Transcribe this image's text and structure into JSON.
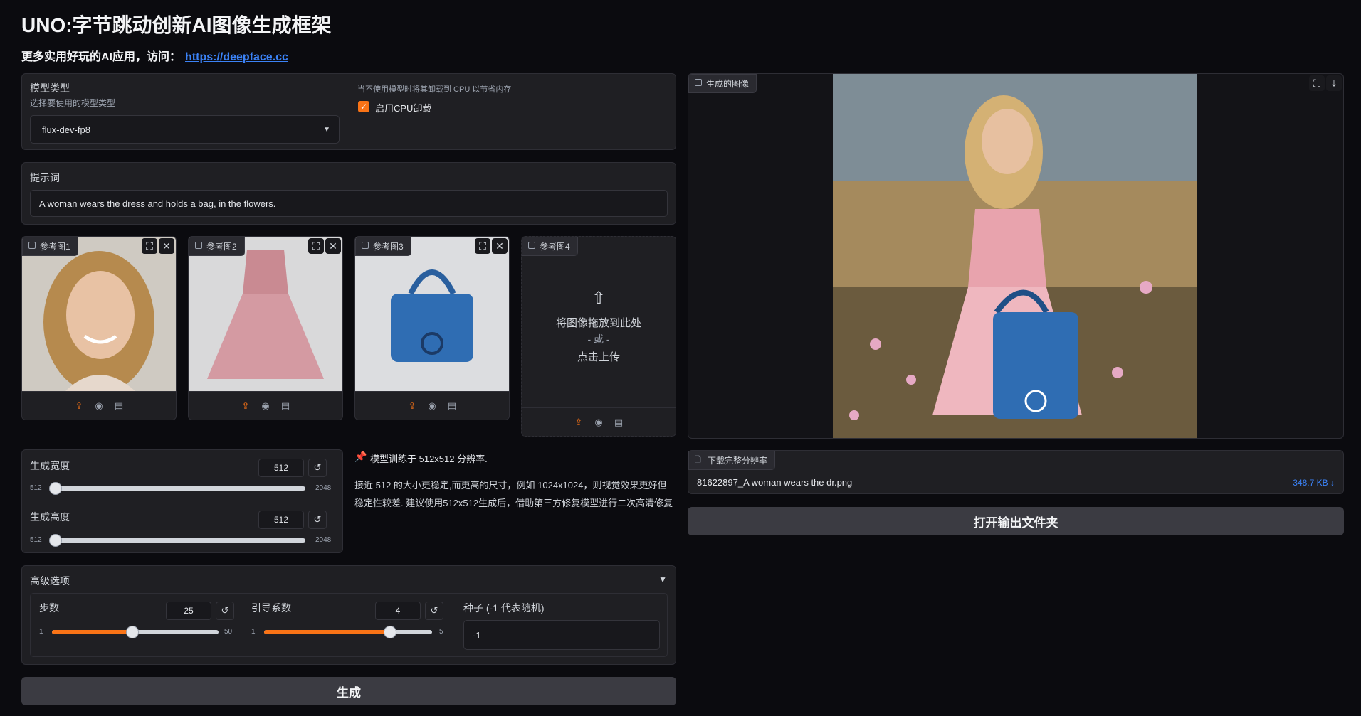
{
  "header": {
    "title": "UNO:字节跳动创新AI图像生成框架",
    "subtitle_prefix": "更多实用好玩的AI应用，访问：",
    "link": "https://deepface.cc"
  },
  "model": {
    "label": "模型类型",
    "sublabel": "选择要使用的模型类型",
    "value": "flux-dev-fp8",
    "cpu_note": "当不使用模型时将其卸载到 CPU 以节省内存",
    "cpu_label": "启用CPU卸载",
    "cpu_checked": true
  },
  "prompt": {
    "label": "提示词",
    "value": "A woman wears the dress and holds a bag, in the flowers."
  },
  "refs": [
    {
      "label": "参考图1"
    },
    {
      "label": "参考图2"
    },
    {
      "label": "参考图3"
    },
    {
      "label": "参考图4",
      "drop_text": "将图像拖放到此处",
      "or_text": "- 或 -",
      "click_text": "点击上传"
    }
  ],
  "size": {
    "width_label": "生成宽度",
    "width_value": "512",
    "height_label": "生成高度",
    "height_value": "512",
    "min": "512",
    "max": "2048"
  },
  "note": {
    "title": "模型训练于 512x512 分辨率.",
    "body": "接近 512 的大小更稳定,而更高的尺寸，例如 1024x1024，则视觉效果更好但稳定性较差. 建议使用512x512生成后，借助第三方修复模型进行二次高清修复"
  },
  "advanced": {
    "label": "高级选项",
    "steps_label": "步数",
    "steps_value": "25",
    "steps_min": "1",
    "steps_max": "50",
    "guidance_label": "引导系数",
    "guidance_value": "4",
    "guidance_min": "1",
    "guidance_max": "5",
    "seed_label": "种子 (-1 代表随机)",
    "seed_value": "-1"
  },
  "generate_label": "生成",
  "output": {
    "image_label": "生成的图像",
    "download_label": "下载完整分辨率",
    "file_name": "81622897_A woman wears the dr.png",
    "file_size": "348.7 KB ↓",
    "open_folder_label": "打开输出文件夹"
  },
  "colors": {
    "accent": "#f97316",
    "link": "#3b82f6",
    "background": "#0b0b0f",
    "panel": "#1f1f23"
  }
}
